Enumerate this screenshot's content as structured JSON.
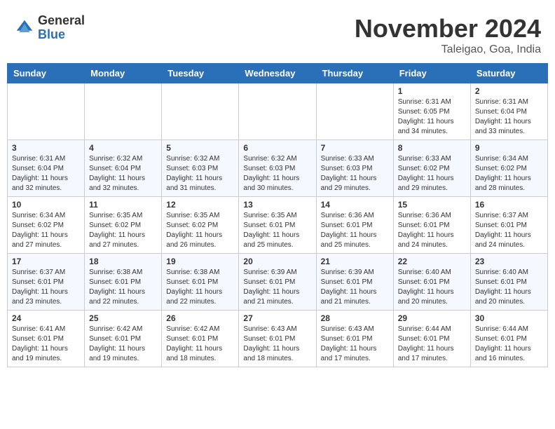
{
  "header": {
    "logo_general": "General",
    "logo_blue": "Blue",
    "month_title": "November 2024",
    "location": "Taleigao, Goa, India"
  },
  "weekdays": [
    "Sunday",
    "Monday",
    "Tuesday",
    "Wednesday",
    "Thursday",
    "Friday",
    "Saturday"
  ],
  "weeks": [
    [
      {
        "day": "",
        "info": ""
      },
      {
        "day": "",
        "info": ""
      },
      {
        "day": "",
        "info": ""
      },
      {
        "day": "",
        "info": ""
      },
      {
        "day": "",
        "info": ""
      },
      {
        "day": "1",
        "info": "Sunrise: 6:31 AM\nSunset: 6:05 PM\nDaylight: 11 hours\nand 34 minutes."
      },
      {
        "day": "2",
        "info": "Sunrise: 6:31 AM\nSunset: 6:04 PM\nDaylight: 11 hours\nand 33 minutes."
      }
    ],
    [
      {
        "day": "3",
        "info": "Sunrise: 6:31 AM\nSunset: 6:04 PM\nDaylight: 11 hours\nand 32 minutes."
      },
      {
        "day": "4",
        "info": "Sunrise: 6:32 AM\nSunset: 6:04 PM\nDaylight: 11 hours\nand 32 minutes."
      },
      {
        "day": "5",
        "info": "Sunrise: 6:32 AM\nSunset: 6:03 PM\nDaylight: 11 hours\nand 31 minutes."
      },
      {
        "day": "6",
        "info": "Sunrise: 6:32 AM\nSunset: 6:03 PM\nDaylight: 11 hours\nand 30 minutes."
      },
      {
        "day": "7",
        "info": "Sunrise: 6:33 AM\nSunset: 6:03 PM\nDaylight: 11 hours\nand 29 minutes."
      },
      {
        "day": "8",
        "info": "Sunrise: 6:33 AM\nSunset: 6:02 PM\nDaylight: 11 hours\nand 29 minutes."
      },
      {
        "day": "9",
        "info": "Sunrise: 6:34 AM\nSunset: 6:02 PM\nDaylight: 11 hours\nand 28 minutes."
      }
    ],
    [
      {
        "day": "10",
        "info": "Sunrise: 6:34 AM\nSunset: 6:02 PM\nDaylight: 11 hours\nand 27 minutes."
      },
      {
        "day": "11",
        "info": "Sunrise: 6:35 AM\nSunset: 6:02 PM\nDaylight: 11 hours\nand 27 minutes."
      },
      {
        "day": "12",
        "info": "Sunrise: 6:35 AM\nSunset: 6:02 PM\nDaylight: 11 hours\nand 26 minutes."
      },
      {
        "day": "13",
        "info": "Sunrise: 6:35 AM\nSunset: 6:01 PM\nDaylight: 11 hours\nand 25 minutes."
      },
      {
        "day": "14",
        "info": "Sunrise: 6:36 AM\nSunset: 6:01 PM\nDaylight: 11 hours\nand 25 minutes."
      },
      {
        "day": "15",
        "info": "Sunrise: 6:36 AM\nSunset: 6:01 PM\nDaylight: 11 hours\nand 24 minutes."
      },
      {
        "day": "16",
        "info": "Sunrise: 6:37 AM\nSunset: 6:01 PM\nDaylight: 11 hours\nand 24 minutes."
      }
    ],
    [
      {
        "day": "17",
        "info": "Sunrise: 6:37 AM\nSunset: 6:01 PM\nDaylight: 11 hours\nand 23 minutes."
      },
      {
        "day": "18",
        "info": "Sunrise: 6:38 AM\nSunset: 6:01 PM\nDaylight: 11 hours\nand 22 minutes."
      },
      {
        "day": "19",
        "info": "Sunrise: 6:38 AM\nSunset: 6:01 PM\nDaylight: 11 hours\nand 22 minutes."
      },
      {
        "day": "20",
        "info": "Sunrise: 6:39 AM\nSunset: 6:01 PM\nDaylight: 11 hours\nand 21 minutes."
      },
      {
        "day": "21",
        "info": "Sunrise: 6:39 AM\nSunset: 6:01 PM\nDaylight: 11 hours\nand 21 minutes."
      },
      {
        "day": "22",
        "info": "Sunrise: 6:40 AM\nSunset: 6:01 PM\nDaylight: 11 hours\nand 20 minutes."
      },
      {
        "day": "23",
        "info": "Sunrise: 6:40 AM\nSunset: 6:01 PM\nDaylight: 11 hours\nand 20 minutes."
      }
    ],
    [
      {
        "day": "24",
        "info": "Sunrise: 6:41 AM\nSunset: 6:01 PM\nDaylight: 11 hours\nand 19 minutes."
      },
      {
        "day": "25",
        "info": "Sunrise: 6:42 AM\nSunset: 6:01 PM\nDaylight: 11 hours\nand 19 minutes."
      },
      {
        "day": "26",
        "info": "Sunrise: 6:42 AM\nSunset: 6:01 PM\nDaylight: 11 hours\nand 18 minutes."
      },
      {
        "day": "27",
        "info": "Sunrise: 6:43 AM\nSunset: 6:01 PM\nDaylight: 11 hours\nand 18 minutes."
      },
      {
        "day": "28",
        "info": "Sunrise: 6:43 AM\nSunset: 6:01 PM\nDaylight: 11 hours\nand 17 minutes."
      },
      {
        "day": "29",
        "info": "Sunrise: 6:44 AM\nSunset: 6:01 PM\nDaylight: 11 hours\nand 17 minutes."
      },
      {
        "day": "30",
        "info": "Sunrise: 6:44 AM\nSunset: 6:01 PM\nDaylight: 11 hours\nand 16 minutes."
      }
    ]
  ]
}
